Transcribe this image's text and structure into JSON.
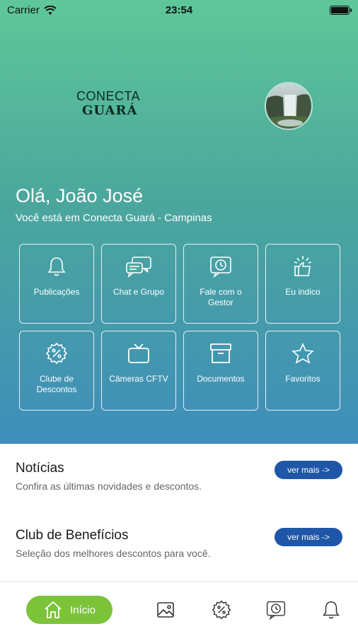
{
  "status": {
    "carrier": "Carrier",
    "time": "23:54",
    "battery_level": 1.0
  },
  "brand": {
    "logo_top": "CONECTA",
    "logo_bottom": "GUARÁ"
  },
  "user": {
    "greeting": "Olá, João José",
    "location": "Você está em Conecta Guará - Campinas"
  },
  "tiles": [
    {
      "label": "Publicações",
      "icon": "bell-icon"
    },
    {
      "label": "Chat e Grupo",
      "icon": "chat-bubbles-icon"
    },
    {
      "label": "Fale com o Gestor",
      "icon": "clock-message-icon"
    },
    {
      "label": "Eu indico",
      "icon": "thumbs-up-icon"
    },
    {
      "label": "Clube de Descontos",
      "icon": "discount-badge-icon"
    },
    {
      "label": "Câmeras CFTV",
      "icon": "tv-icon"
    },
    {
      "label": "Documentos",
      "icon": "archive-box-icon"
    },
    {
      "label": "Favoritos",
      "icon": "star-icon"
    }
  ],
  "news": {
    "title": "Notícias",
    "subtitle": "Confira as últimas novidades e descontos.",
    "more_label": "ver mais ->"
  },
  "benefits": {
    "title": "Club de Benefícios",
    "subtitle": "Seleção dos melhores descontos para você.",
    "more_label": "ver mais ->"
  },
  "tabbar": {
    "home_label": "Início",
    "items": [
      "home-icon",
      "gallery-icon",
      "discount-badge-icon",
      "clock-message-icon",
      "bell-icon"
    ],
    "active_color": "#7cc33a"
  },
  "colors": {
    "accent": "#1f56a8",
    "gradient_top": "#5fc79a",
    "gradient_bottom": "#3f8ebb"
  }
}
